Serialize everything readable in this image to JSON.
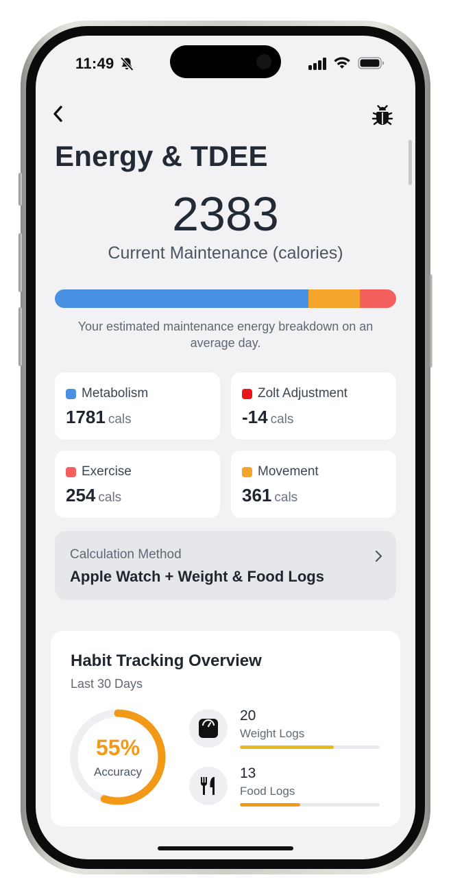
{
  "status_bar": {
    "time": "11:49",
    "icons": [
      "bell-slash-icon",
      "cellular-signal-icon",
      "wifi-icon",
      "battery-icon"
    ]
  },
  "header": {
    "back_icon": "chevron-left-icon",
    "debug_icon": "bug-icon"
  },
  "page_title": "Energy & TDEE",
  "maintenance": {
    "value": "2383",
    "label": "Current Maintenance (calories)"
  },
  "breakdown_bar": {
    "segments": [
      {
        "name": "Metabolism",
        "calories": 1781,
        "color": "#4a90e2"
      },
      {
        "name": "Movement",
        "calories": 361,
        "color": "#f2a52a"
      },
      {
        "name": "Exercise",
        "calories": 254,
        "color": "#f25f5c"
      }
    ],
    "caption": "Your estimated maintenance energy breakdown on an average day."
  },
  "stats": [
    {
      "label": "Metabolism",
      "value": "1781",
      "unit": "cals",
      "color": "#4a90e2"
    },
    {
      "label": "Zolt Adjustment",
      "value": "-14",
      "unit": "cals",
      "color": "#e8161b"
    },
    {
      "label": "Exercise",
      "value": "254",
      "unit": "cals",
      "color": "#f25f5c"
    },
    {
      "label": "Movement",
      "value": "361",
      "unit": "cals",
      "color": "#f2a52a"
    }
  ],
  "calculation_method": {
    "label": "Calculation Method",
    "value": "Apple Watch + Weight & Food Logs",
    "icon": "chevron-right-icon"
  },
  "habit_tracking": {
    "title": "Habit Tracking Overview",
    "subtitle": "Last 30 Days",
    "accuracy": {
      "percent": "55%",
      "fraction": 0.55,
      "label": "Accuracy",
      "color": "#f29a18"
    },
    "items": [
      {
        "count": "20",
        "label": "Weight Logs",
        "icon": "scale-icon",
        "progress": 0.67,
        "color": "#e8b91e"
      },
      {
        "count": "13",
        "label": "Food Logs",
        "icon": "fork-knife-icon",
        "progress": 0.43,
        "color": "#f29a18"
      }
    ]
  }
}
